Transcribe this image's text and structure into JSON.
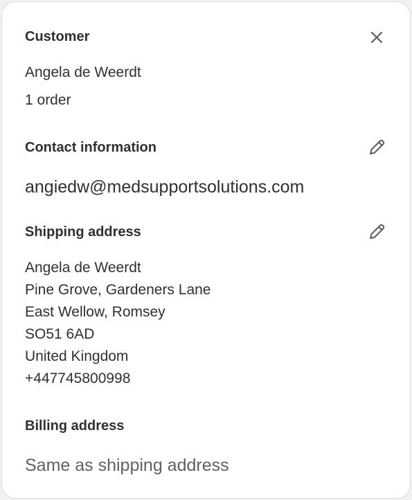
{
  "customer": {
    "heading": "Customer",
    "name": "Angela de Weerdt",
    "orders": "1 order"
  },
  "contact": {
    "heading": "Contact information",
    "email": "angiedw@medsupportsolutions.com"
  },
  "shipping": {
    "heading": "Shipping address",
    "lines": [
      "Angela de Weerdt",
      "Pine Grove, Gardeners Lane",
      "East Wellow, Romsey",
      "SO51 6AD",
      "United Kingdom",
      "+447745800998"
    ]
  },
  "billing": {
    "heading": "Billing address",
    "value": "Same as shipping address"
  },
  "icons": {
    "close": "close-icon",
    "edit_contact": "pencil-icon",
    "edit_shipping": "pencil-icon"
  },
  "colors": {
    "text": "#303030",
    "muted": "#616161",
    "icon": "#5c5c5c"
  }
}
